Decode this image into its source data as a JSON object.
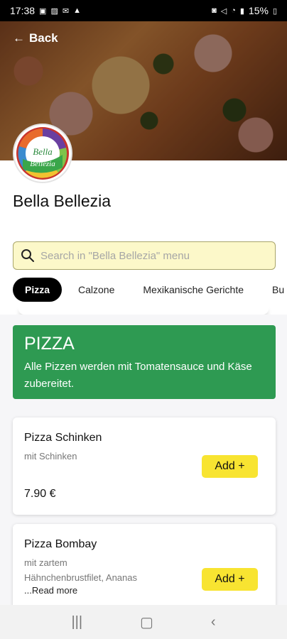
{
  "status": {
    "time": "17:38",
    "left_icons": [
      "photo-icon",
      "gallery-icon",
      "mail-icon",
      "warning-icon"
    ],
    "right_icons": [
      "battery-saver-icon",
      "mute-icon",
      "wifi-icon",
      "volte-icon",
      "signal-icon"
    ],
    "battery": "15%"
  },
  "header": {
    "back_label": "Back"
  },
  "restaurant": {
    "name": "Bella Bellezia",
    "logo_text_1": "Bella",
    "logo_text_2": "Bellezia"
  },
  "search": {
    "placeholder": "Search in \"Bella Bellezia\" menu"
  },
  "tabs": [
    {
      "label": "Pizza",
      "active": true
    },
    {
      "label": "Calzone"
    },
    {
      "label": "Mexikanische Gerichte"
    },
    {
      "label": "Bu"
    }
  ],
  "category": {
    "title": "PIZZA",
    "description": "Alle Pizzen werden mit Tomatensauce und Käse zubereitet."
  },
  "items": [
    {
      "name": "Pizza Schinken",
      "description": "mit Schinken",
      "price": "7.90 €",
      "add_label": "Add +"
    },
    {
      "name": "Pizza Bombay",
      "description_1": "mit zartem",
      "description_2": "Hähnchenbrustfilet, Ananas",
      "read_more": "...Read more",
      "add_label": "Add +"
    }
  ],
  "colors": {
    "accent_yellow": "#f8e431",
    "category_green": "#2e9a52",
    "search_bg": "#fcf8c9"
  },
  "nav": {
    "icons": [
      "recents-icon",
      "home-icon",
      "back-nav-icon"
    ]
  }
}
